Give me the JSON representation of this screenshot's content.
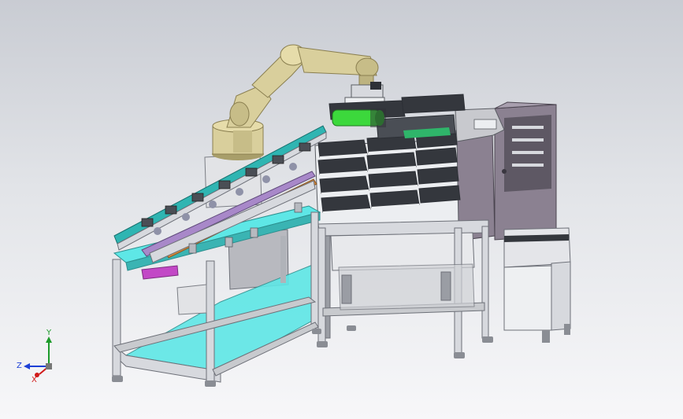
{
  "view": {
    "background_top": "#c9ccd3",
    "background_bottom": "#f7f7f9"
  },
  "triad": {
    "x_label": "X",
    "y_label": "Y",
    "z_label": "Z",
    "colors": {
      "x": "#d11a1a",
      "y": "#1c9a2a",
      "z": "#1d3fd6"
    }
  },
  "palette": {
    "robot_body": "#d9cf9c",
    "robot_shadow": "#a89e6a",
    "frame": "#d7d9de",
    "frame_dark": "#8a8d94",
    "shelf_glass": "#5ee7e6",
    "cabinet_panel": "#8b8191",
    "cabinet_dark": "#5d5663",
    "gripper_green": "#3cd83c",
    "rail_teal": "#2fb5b2",
    "guide_orange": "#d78a3c",
    "guide_purple": "#a888c9",
    "magenta_part": "#c248c6",
    "tray_dark": "#34373d"
  }
}
